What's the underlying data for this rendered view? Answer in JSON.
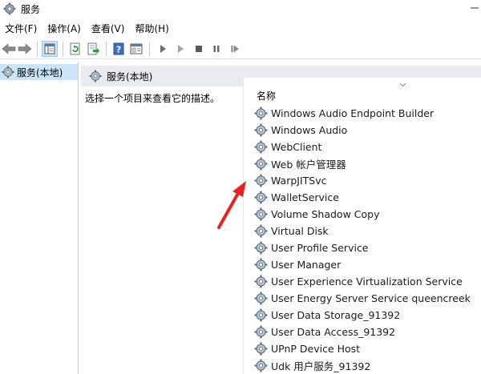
{
  "window": {
    "title": "服务"
  },
  "menu": [
    "文件(F)",
    "操作(A)",
    "查看(V)",
    "帮助(H)"
  ],
  "toolbar": {
    "icons": [
      "back-arrow-icon",
      "forward-arrow-icon",
      "show-hide-tree-icon",
      "refresh-icon",
      "export-list-icon",
      "help-icon",
      "properties-icon",
      "start-service-icon",
      "start-alt-icon",
      "stop-service-icon",
      "pause-service-icon",
      "restart-service-icon"
    ]
  },
  "tree": {
    "root_label": "服务(本地)"
  },
  "content": {
    "header_title": "服务(本地)",
    "description": "选择一个项目来查看它的描述。",
    "column_name": "名称",
    "services": [
      "Windows Audio Endpoint Builder",
      "Windows Audio",
      "WebClient",
      "Web 帐户管理器",
      "WarpJITSvc",
      "WalletService",
      "Volume Shadow Copy",
      "Virtual Disk",
      "User Profile Service",
      "User Manager",
      "User Experience Virtualization Service",
      "User Energy Server Service queencreek",
      "User Data Storage_91392",
      "User Data Access_91392",
      "UPnP Device Host",
      "Udk 用户服务_91392"
    ]
  },
  "colors": {
    "selection": "#cce4f7",
    "header_bg": "#e8ecf1",
    "annotation_arrow": "#e8231f"
  }
}
